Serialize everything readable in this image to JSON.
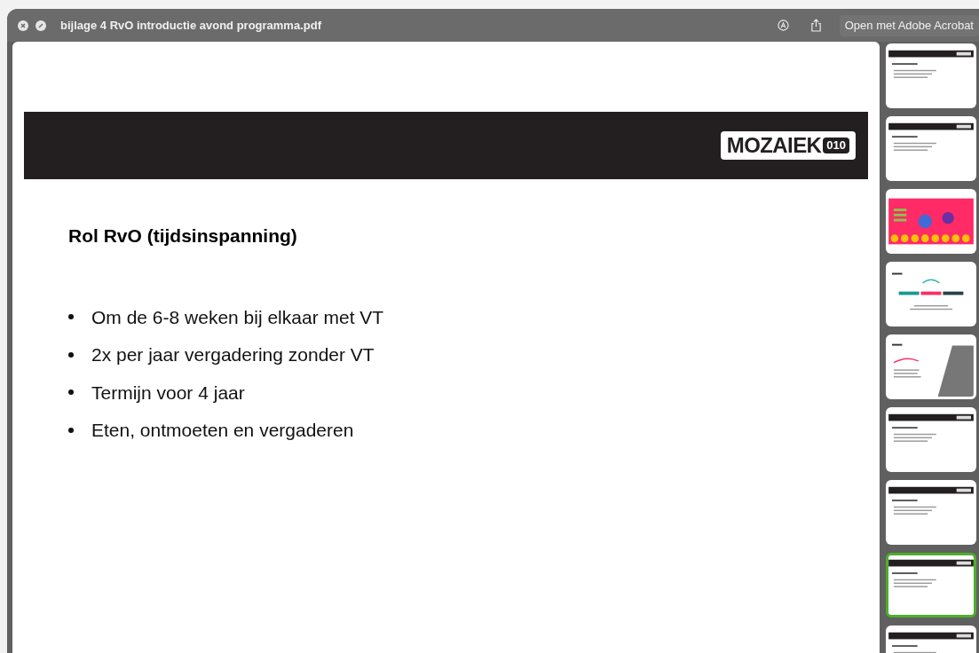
{
  "window": {
    "title": "bijlage 4 RvO introductie avond programma.pdf",
    "open_button": "Open met Adobe Acrobat"
  },
  "slide": {
    "logo": {
      "text": "MOZAIEK",
      "badge": "010"
    },
    "heading": "Rol RvO (tijdsinspanning)",
    "bullets": [
      "Om de 6-8 weken bij elkaar met VT",
      "2x per jaar vergadering zonder VT",
      "Termijn voor 4 jaar",
      "Eten, ontmoeten en vergaderen"
    ]
  },
  "thumbnails": [
    {
      "kind": "text",
      "selected": false
    },
    {
      "kind": "text",
      "selected": false
    },
    {
      "kind": "pink",
      "selected": false
    },
    {
      "kind": "vision",
      "selected": false
    },
    {
      "kind": "photo",
      "selected": false
    },
    {
      "kind": "text",
      "selected": false
    },
    {
      "kind": "text",
      "selected": false
    },
    {
      "kind": "text",
      "selected": true
    },
    {
      "kind": "text",
      "selected": false
    }
  ]
}
